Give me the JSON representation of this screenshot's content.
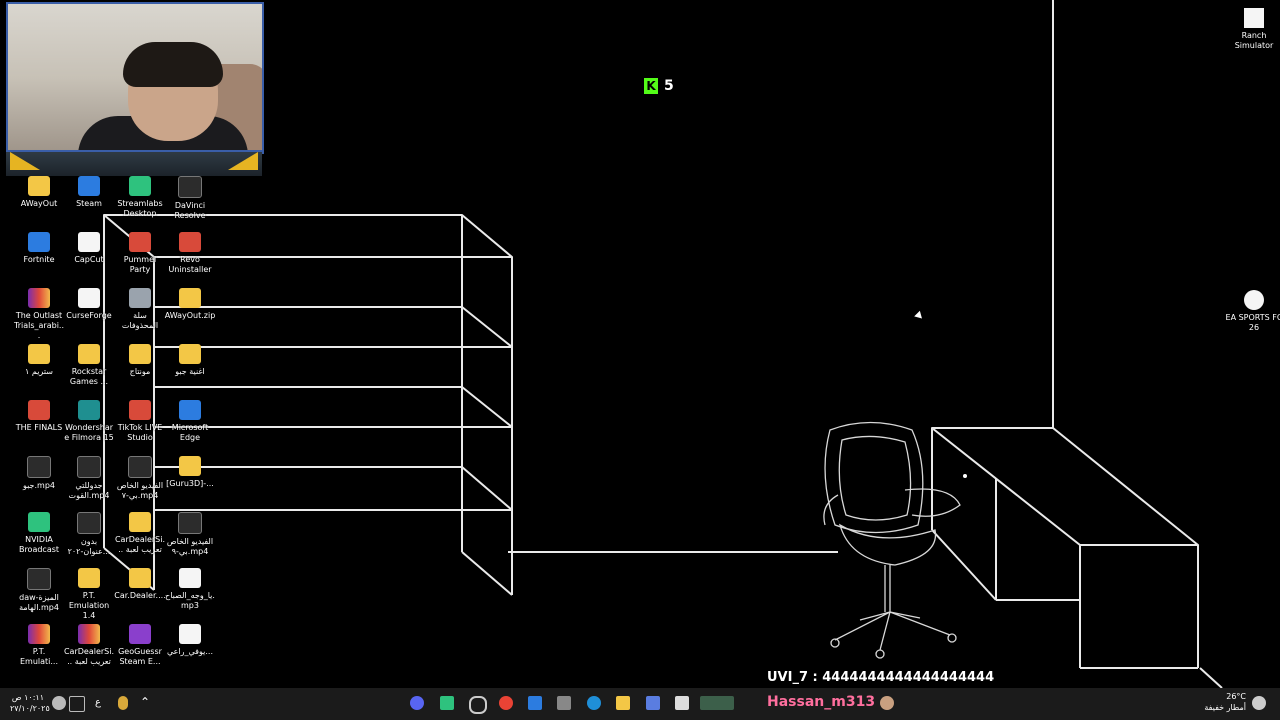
{
  "kick_viewers": "5",
  "desktop_icons": [
    {
      "label": "AWayOut",
      "icon": "folder-icon"
    },
    {
      "label": "Steam",
      "icon": "steam-icon"
    },
    {
      "label": "Streamlabs Desktop",
      "icon": "streamlabs-icon"
    },
    {
      "label": "DaVinci Resolve",
      "icon": "davinci-icon"
    },
    {
      "label": "Fortnite",
      "icon": "fortnite-icon"
    },
    {
      "label": "CapCut",
      "icon": "capcut-icon"
    },
    {
      "label": "Pummel Party",
      "icon": "pummel-party-icon"
    },
    {
      "label": "Revo Uninstaller",
      "icon": "revo-icon"
    },
    {
      "label": "The Outlast Trials_arabi...",
      "icon": "rar-icon"
    },
    {
      "label": "CurseForge",
      "icon": "curseforge-icon"
    },
    {
      "label": "سلة المحذوفات",
      "icon": "recycle-bin-icon"
    },
    {
      "label": "AWayOut.zip",
      "icon": "zip-folder-icon"
    },
    {
      "label": "ستريم ١",
      "icon": "folder-icon"
    },
    {
      "label": "Rockstar Games ...",
      "icon": "rockstar-icon"
    },
    {
      "label": "مونتاج",
      "icon": "folder-icon"
    },
    {
      "label": "اغنية جبو",
      "icon": "folder-icon"
    },
    {
      "label": "THE FINALS",
      "icon": "the-finals-icon"
    },
    {
      "label": "Wondershare Filmora 15",
      "icon": "filmora-icon"
    },
    {
      "label": "TikTok LIVE Studio",
      "icon": "tiktok-icon"
    },
    {
      "label": "Microsoft Edge",
      "icon": "edge-icon"
    },
    {
      "label": "جبو.mp4",
      "icon": "video-file-icon"
    },
    {
      "label": "جدوللتي القوت.mp4",
      "icon": "video-file-icon"
    },
    {
      "label": "الفيديو الخاص بي-٧.mp4",
      "icon": "video-file-icon"
    },
    {
      "label": "[Guru3D]-...",
      "icon": "folder-icon"
    },
    {
      "label": "NVIDIA Broadcast",
      "icon": "nvidia-icon"
    },
    {
      "label": "بدون عنوان-٢٠٢...",
      "icon": "video-file-icon"
    },
    {
      "label": "CarDealerSi... تعريب لعبة",
      "icon": "folder-icon"
    },
    {
      "label": "الفيديو الخاص بي-٩.mp4",
      "icon": "video-file-icon"
    },
    {
      "label": "daw-الميزة الهامة.mp4",
      "icon": "video-file-icon"
    },
    {
      "label": "P.T. Emulation 1.4",
      "icon": "folder-icon"
    },
    {
      "label": "Car.Dealer....",
      "icon": "folder-icon"
    },
    {
      "label": "يا_وجه_الصباح.mp3",
      "icon": "audio-file-icon"
    },
    {
      "label": "P.T. Emulati...",
      "icon": "rar-icon"
    },
    {
      "label": "CarDealerSi... تعريب لعبة",
      "icon": "rar-icon"
    },
    {
      "label": "GeoGuessr Steam E...",
      "icon": "geoguessr-icon"
    },
    {
      "label": "يوفي_راعي...",
      "icon": "audio-file-icon"
    }
  ],
  "right_icons": [
    {
      "label": "Ranch Simulator",
      "icon": "ranch-simulator-icon"
    },
    {
      "label": "EA SPORTS FC 26",
      "icon": "ea-sports-fc-icon"
    }
  ],
  "chat": {
    "user": "UVI_7",
    "message": "4444444444444444444"
  },
  "taskbar": {
    "time": "١٠:١١ ص",
    "date": "٢٧/١٠/٢٠٢٥",
    "lang": "ع",
    "username": "Hassan_m313",
    "weather_temp": "26°C",
    "weather_desc": "أمطار خفيفة"
  }
}
